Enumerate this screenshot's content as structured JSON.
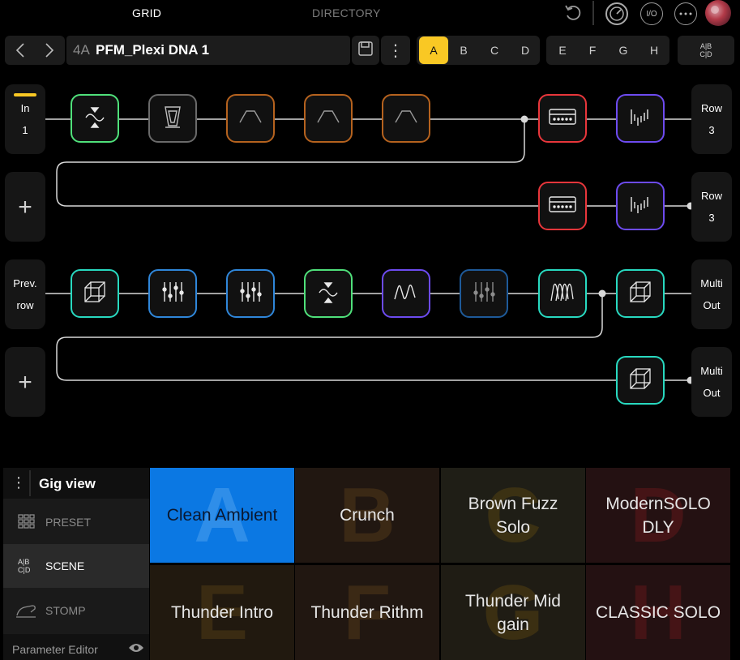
{
  "nav": {
    "grid": "GRID",
    "directory": "DIRECTORY",
    "io": "I/O"
  },
  "preset": {
    "number": "4A",
    "name": "PFM_Plexi DNA 1",
    "more": "⋮"
  },
  "scenes": {
    "A": "A",
    "B": "B",
    "C": "C",
    "D": "D",
    "E": "E",
    "F": "F",
    "G": "G",
    "H": "H",
    "ab": "A|B",
    "cd": "C|D"
  },
  "grid": {
    "row1": {
      "in_label": "In",
      "in_num": "1",
      "out_label": "Row",
      "out_num": "3"
    },
    "row2": {
      "out_label": "Row",
      "out_num": "3"
    },
    "row3": {
      "in_label": "Prev.",
      "in_num": "row",
      "out_label": "Multi",
      "out_num": "Out"
    },
    "row4": {
      "out_label": "Multi",
      "out_num": "Out"
    },
    "add": "+"
  },
  "colors": {
    "accent": "#f9c824",
    "green": "#4fe07a",
    "orange": "#b5621e",
    "red": "#e8363b",
    "purple": "#6d4bf0",
    "cyan": "#28d9c0",
    "blue": "#2f86d9",
    "gray": "#6a6a6a"
  },
  "gig": {
    "title": "Gig view",
    "menu": "⋮",
    "preset": "PRESET",
    "scene": "SCENE",
    "stomp": "STOMP",
    "param_editor": "Parameter Editor",
    "tiles": [
      {
        "letter": "A",
        "name": "Clean Ambient"
      },
      {
        "letter": "B",
        "name": "Crunch"
      },
      {
        "letter": "C",
        "name": "Brown Fuzz Solo"
      },
      {
        "letter": "D",
        "name": "ModernSOLO DLY"
      },
      {
        "letter": "E",
        "name": "Thunder Intro"
      },
      {
        "letter": "F",
        "name": "Thunder Rithm"
      },
      {
        "letter": "G",
        "name": "Thunder Mid gain"
      },
      {
        "letter": "H",
        "name": "CLASSIC SOLO"
      }
    ]
  }
}
